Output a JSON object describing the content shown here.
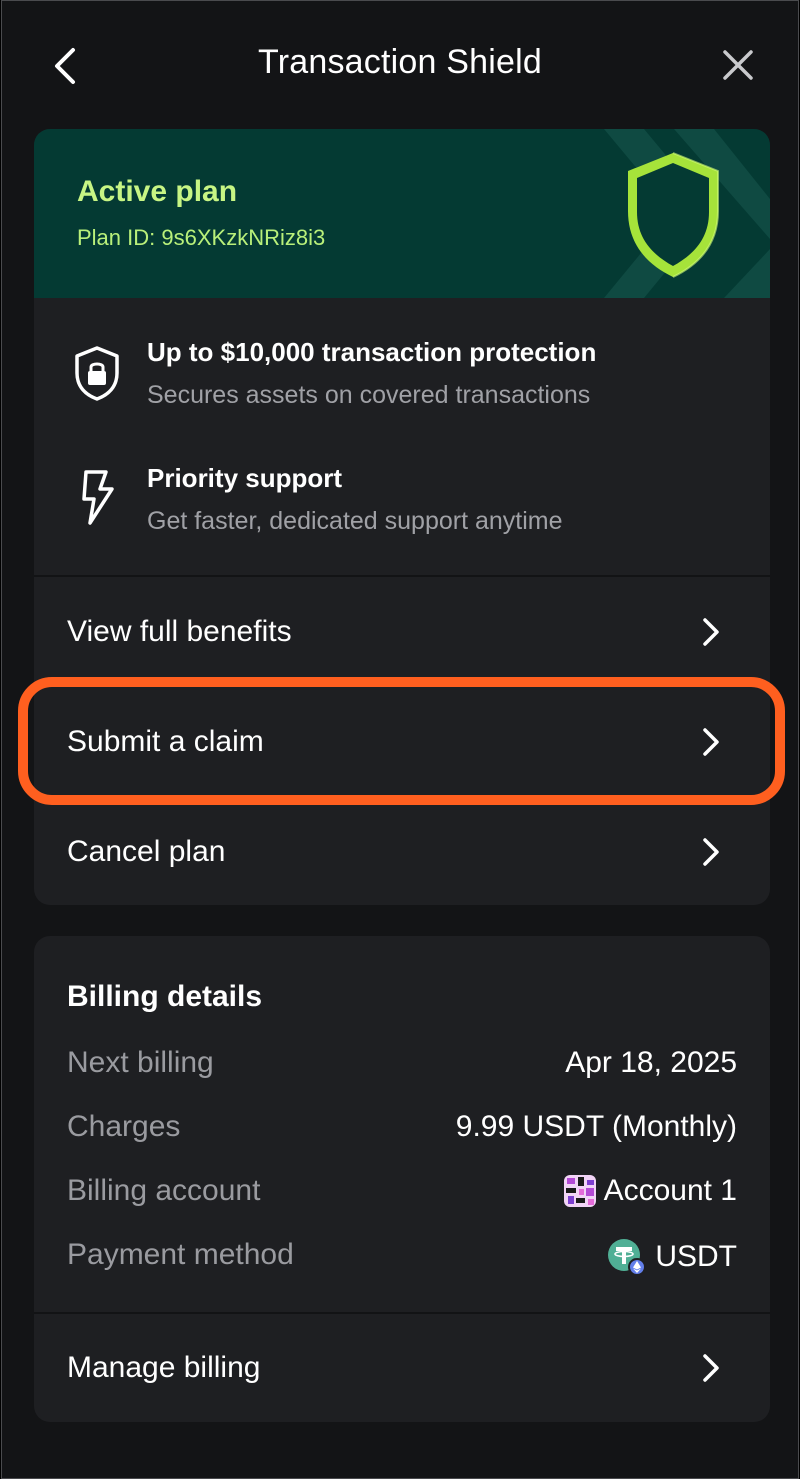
{
  "header": {
    "title": "Transaction Shield",
    "back_icon": "chevron-left-icon",
    "close_icon": "close-icon"
  },
  "plan": {
    "status": "Active plan",
    "plan_id": "Plan ID: 9s6XKzkNRiz8i3",
    "benefits": [
      {
        "icon": "shield-lock-icon",
        "title": "Up to $10,000 transaction protection",
        "subtitle": "Secures assets on covered transactions"
      },
      {
        "icon": "lightning-icon",
        "title": "Priority support",
        "subtitle": "Get faster, dedicated support anytime"
      }
    ],
    "actions": [
      {
        "label": "View full benefits"
      },
      {
        "label": "Submit a claim"
      },
      {
        "label": "Cancel plan"
      }
    ]
  },
  "billing": {
    "title": "Billing details",
    "rows": [
      {
        "label": "Next billing",
        "value": "Apr 18, 2025"
      },
      {
        "label": "Charges",
        "value": "9.99 USDT (Monthly)"
      },
      {
        "label": "Billing account",
        "value": "Account 1"
      },
      {
        "label": "Payment method",
        "value": "USDT"
      }
    ],
    "manage_label": "Manage billing"
  },
  "colors": {
    "background": "#131416",
    "card": "#1e1f22",
    "banner": "#043a33",
    "accent_green": "#c7f584",
    "highlight": "#ff5f1f",
    "usdt": "#50af95"
  }
}
